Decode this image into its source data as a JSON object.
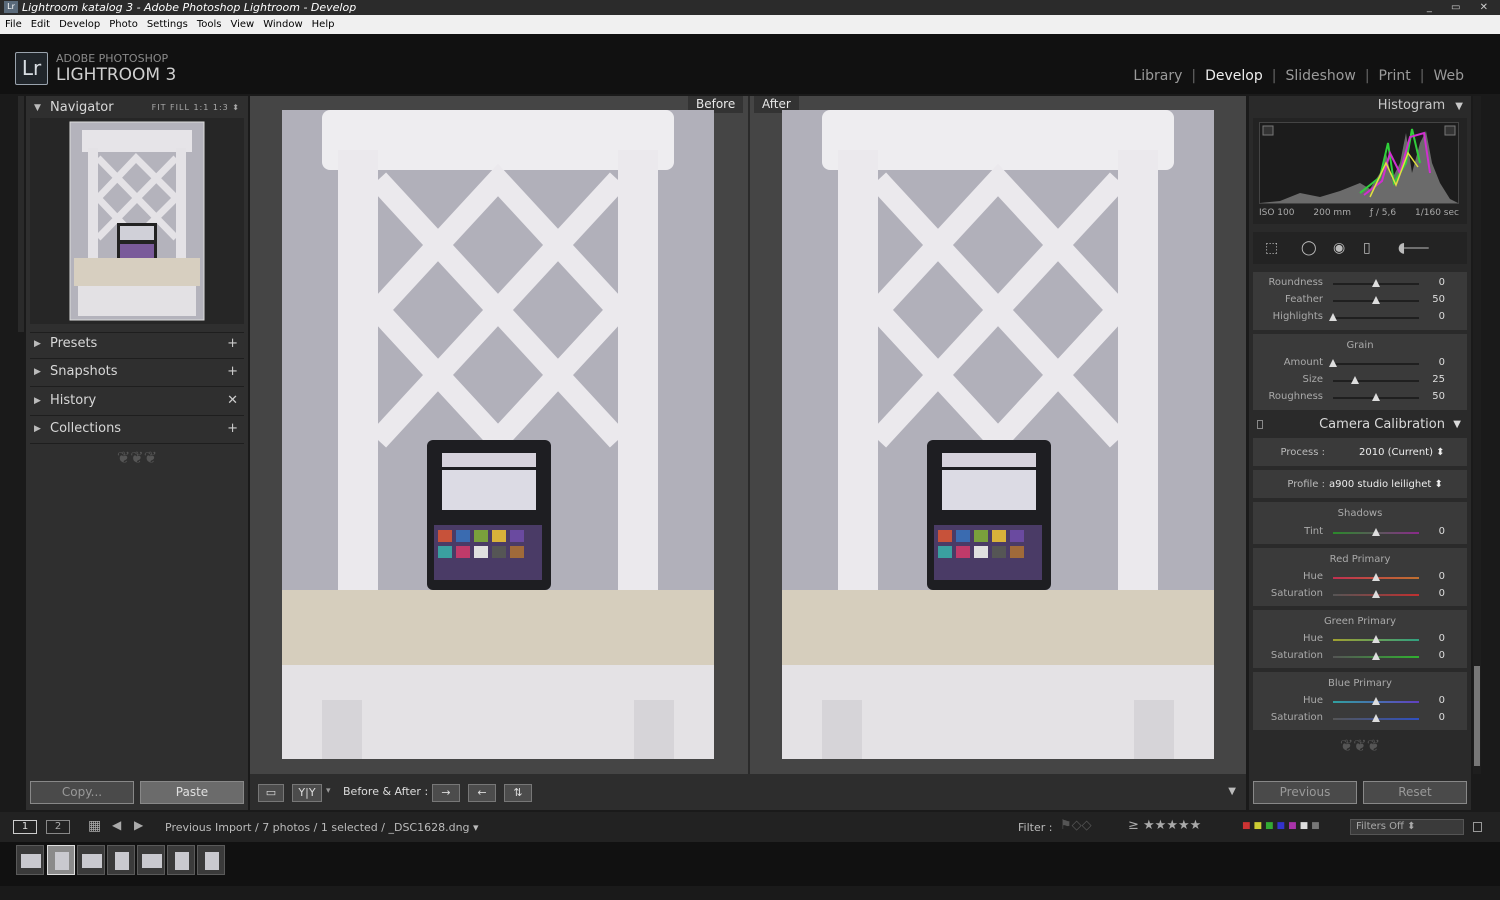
{
  "window": {
    "title": "Lightroom katalog 3 - Adobe Photoshop Lightroom - Develop",
    "app_icon": "Lr",
    "controls": "_ ▭ ✕"
  },
  "menu": [
    "File",
    "Edit",
    "Develop",
    "Photo",
    "Settings",
    "Tools",
    "View",
    "Window",
    "Help"
  ],
  "brand": {
    "logo": "Lr",
    "line1": "ADOBE PHOTOSHOP",
    "line2": "LIGHTROOM 3"
  },
  "modules": {
    "library": "Library",
    "develop": "Develop",
    "slideshow": "Slideshow",
    "print": "Print",
    "web": "Web",
    "sep": "|"
  },
  "left": {
    "navigator": {
      "title": "Navigator",
      "options": "FIT  FILL  1:1  1:3 ⬍"
    },
    "panels": [
      {
        "label": "Presets",
        "action": "+"
      },
      {
        "label": "Snapshots",
        "action": "+"
      },
      {
        "label": "History",
        "action": "✕"
      },
      {
        "label": "Collections",
        "action": "+"
      }
    ],
    "ornament": "❦❦❦",
    "copy": "Copy...",
    "paste": "Paste"
  },
  "center": {
    "before": "Before",
    "after": "After"
  },
  "toolbar": {
    "yy": "Y|Y",
    "before_after": "Before & After :",
    "btn1": "→",
    "btn2": "←",
    "btn3": "⇅",
    "dropdown": "▼"
  },
  "right": {
    "histogram": {
      "title": "Histogram",
      "iso": "ISO 100",
      "focal": "200 mm",
      "aperture": "ƒ / 5,6",
      "shutter": "1/160 sec"
    },
    "vignette": [
      {
        "label": "Roundness",
        "value": "0",
        "pos": 0.5
      },
      {
        "label": "Feather",
        "value": "50",
        "pos": 0.5
      },
      {
        "label": "Highlights",
        "value": "0",
        "pos": 0.0
      }
    ],
    "grain": {
      "title": "Grain",
      "rows": [
        {
          "label": "Amount",
          "value": "0",
          "pos": 0.0
        },
        {
          "label": "Size",
          "value": "25",
          "pos": 0.25
        },
        {
          "label": "Roughness",
          "value": "50",
          "pos": 0.5
        }
      ]
    },
    "calibration": {
      "title": "Camera Calibration",
      "process_label": "Process :",
      "process_value": "2010 (Current) ⬍",
      "profile_label": "Profile :",
      "profile_value": "a900 studio leilighet ⬍",
      "shadows": {
        "title": "Shadows",
        "rows": [
          {
            "label": "Tint",
            "value": "0",
            "pos": 0.5
          }
        ]
      },
      "red": {
        "title": "Red Primary",
        "rows": [
          {
            "label": "Hue",
            "value": "0",
            "pos": 0.5
          },
          {
            "label": "Saturation",
            "value": "0",
            "pos": 0.5
          }
        ]
      },
      "green": {
        "title": "Green Primary",
        "rows": [
          {
            "label": "Hue",
            "value": "0",
            "pos": 0.5
          },
          {
            "label": "Saturation",
            "value": "0",
            "pos": 0.5
          }
        ]
      },
      "blue": {
        "title": "Blue Primary",
        "rows": [
          {
            "label": "Hue",
            "value": "0",
            "pos": 0.5
          },
          {
            "label": "Saturation",
            "value": "0",
            "pos": 0.5
          }
        ]
      }
    },
    "ornament": "❦❦❦",
    "previous": "Previous",
    "reset": "Reset"
  },
  "bottom": {
    "view1": "1",
    "view2": "2",
    "path": "Previous Import / 7 photos / 1 selected / _DSC1628.dng ▾",
    "filter_label": "Filter :",
    "stars": "≥ ★★★★★",
    "filters_off": "Filters Off ⬍"
  },
  "colors": {
    "accent": "#eeeeee",
    "panel": "#2f2f2f",
    "center": "#454545"
  }
}
